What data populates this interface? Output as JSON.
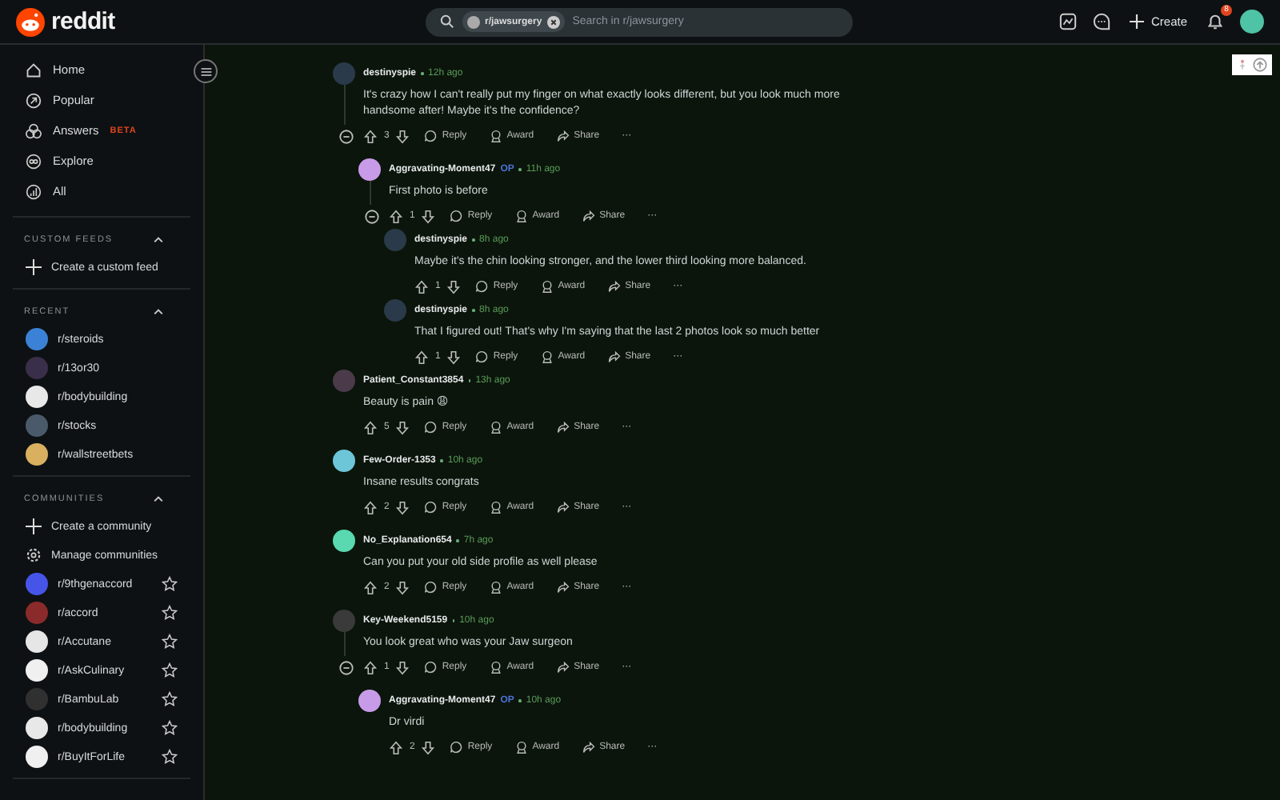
{
  "header": {
    "logo_text": "reddit",
    "search": {
      "chip": "r/jawsurgery",
      "placeholder": "Search in r/jawsurgery"
    },
    "create_label": "Create",
    "notification_count": "8"
  },
  "sidebar": {
    "nav": [
      {
        "label": "Home",
        "selected": false
      },
      {
        "label": "Popular",
        "selected": false
      },
      {
        "label": "Answers",
        "badge": "BETA",
        "selected": false
      },
      {
        "label": "Explore",
        "selected": false
      },
      {
        "label": "All",
        "selected": false
      }
    ],
    "sections": [
      {
        "title": "CUSTOM FEEDS",
        "expanded": true,
        "items": [
          {
            "kind": "create",
            "label": "Create a custom feed"
          }
        ]
      },
      {
        "title": "RECENT",
        "expanded": true,
        "items": [
          {
            "kind": "community",
            "label": "r/steroids",
            "color": "#3b82d6"
          },
          {
            "kind": "community",
            "label": "r/13or30",
            "color": "#3a2f4a"
          },
          {
            "kind": "community",
            "label": "r/bodybuilding",
            "color": "#e8e8e8"
          },
          {
            "kind": "community",
            "label": "r/stocks",
            "color": "#4a5a6a"
          },
          {
            "kind": "community",
            "label": "r/wallstreetbets",
            "color": "#d8b060"
          }
        ]
      },
      {
        "title": "COMMUNITIES",
        "expanded": true,
        "items": [
          {
            "kind": "create",
            "label": "Create a community"
          },
          {
            "kind": "manage",
            "label": "Manage communities"
          },
          {
            "kind": "community",
            "label": "r/9thgenaccord",
            "color": "#4655e8",
            "favorite": false
          },
          {
            "kind": "community",
            "label": "r/accord",
            "color": "#8a2a2a",
            "favorite": false
          },
          {
            "kind": "community",
            "label": "r/Accutane",
            "color": "#e6e6e6",
            "favorite": false
          },
          {
            "kind": "community",
            "label": "r/AskCulinary",
            "color": "#f0f0f0",
            "favorite": false
          },
          {
            "kind": "community",
            "label": "r/BambuLab",
            "color": "#303030",
            "favorite": false
          },
          {
            "kind": "community",
            "label": "r/bodybuilding",
            "color": "#e8e8e8",
            "favorite": false
          },
          {
            "kind": "community",
            "label": "r/BuyItForLife",
            "color": "#f0f0f0",
            "favorite": false
          }
        ]
      }
    ]
  },
  "comments": [
    {
      "author": "destinyspie",
      "time": "12h ago",
      "color": "#2a3a4a",
      "text": "It's crazy how I can't really put my finger on what exactly looks different, but you look much more handsome after! Maybe it's the confidence?",
      "votes": "3",
      "reply": "Reply",
      "award": "Award",
      "share": "Share",
      "more": "···",
      "children": [
        {
          "author": "Aggravating-Moment47",
          "op_label": "OP",
          "time": "11h ago",
          "color": "#c89be8",
          "text": "First photo is before",
          "votes": "1",
          "reply": "Reply",
          "award": "Award",
          "share": "Share",
          "more": "···",
          "children": [
            {
              "author": "destinyspie",
              "time": "8h ago",
              "color": "#2a3a4a",
              "text": "Maybe it's the chin looking stronger, and the lower third looking more balanced.",
              "votes": "1",
              "reply": "Reply",
              "award": "Award",
              "share": "Share",
              "more": "···"
            },
            {
              "author": "destinyspie",
              "time": "8h ago",
              "color": "#2a3a4a",
              "text": "That I figured out! That's why I'm saying that the last 2 photos look so much better",
              "votes": "1",
              "reply": "Reply",
              "award": "Award",
              "share": "Share",
              "more": "···"
            }
          ]
        }
      ]
    },
    {
      "author": "Patient_Constant3854",
      "time": "13h ago",
      "color": "#4a3a4a",
      "text": "Beauty is pain 😩",
      "votes": "5",
      "reply": "Reply",
      "award": "Award",
      "share": "Share",
      "more": "···"
    },
    {
      "author": "Few-Order-1353",
      "time": "10h ago",
      "color": "#6cc6d8",
      "text": "Insane results congrats",
      "votes": "2",
      "reply": "Reply",
      "award": "Award",
      "share": "Share",
      "more": "···"
    },
    {
      "author": "No_Explanation654",
      "time": "7h ago",
      "color": "#5ad8b0",
      "text": "Can you put your old side profile as well please",
      "votes": "2",
      "reply": "Reply",
      "award": "Award",
      "share": "Share",
      "more": "···"
    },
    {
      "author": "Key-Weekend5159",
      "time": "10h ago",
      "color": "#3a3a3a",
      "text": "You look great who was your Jaw surgeon",
      "votes": "1",
      "reply": "Reply",
      "award": "Award",
      "share": "Share",
      "more": "···",
      "children": [
        {
          "author": "Aggravating-Moment47",
          "op_label": "OP",
          "time": "10h ago",
          "color": "#c89be8",
          "text": "Dr virdi",
          "votes": "2",
          "reply": "Reply",
          "award": "Award",
          "share": "Share",
          "more": "···"
        }
      ]
    }
  ]
}
